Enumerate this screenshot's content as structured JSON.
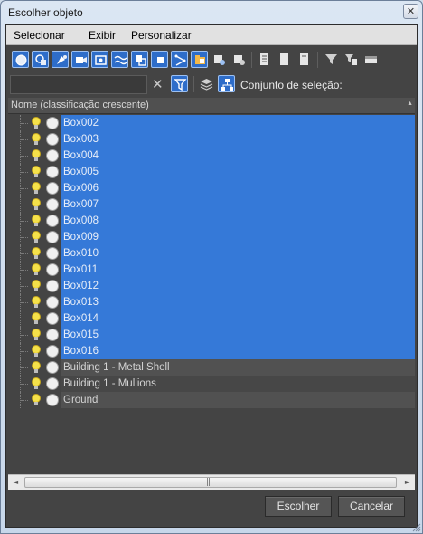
{
  "window": {
    "title": "Escolher objeto",
    "close_label": "✕"
  },
  "menu": [
    "Selecionar",
    "Exibir",
    "Personalizar"
  ],
  "filter": {
    "search_value": "",
    "clear_label": "✕",
    "selection_set_label": "Conjunto de seleção:"
  },
  "list": {
    "header": "Nome (classificação crescente)",
    "sort_indicator": "▲",
    "rows": [
      {
        "name": "Box002",
        "selected": true
      },
      {
        "name": "Box003",
        "selected": true
      },
      {
        "name": "Box004",
        "selected": true
      },
      {
        "name": "Box005",
        "selected": true
      },
      {
        "name": "Box006",
        "selected": true
      },
      {
        "name": "Box007",
        "selected": true
      },
      {
        "name": "Box008",
        "selected": true
      },
      {
        "name": "Box009",
        "selected": true
      },
      {
        "name": "Box010",
        "selected": true
      },
      {
        "name": "Box011",
        "selected": true
      },
      {
        "name": "Box012",
        "selected": true
      },
      {
        "name": "Box013",
        "selected": true
      },
      {
        "name": "Box014",
        "selected": true
      },
      {
        "name": "Box015",
        "selected": true
      },
      {
        "name": "Box016",
        "selected": true
      },
      {
        "name": "Building 1 - Metal Shell",
        "selected": false
      },
      {
        "name": "Building 1 - Mullions",
        "selected": false
      },
      {
        "name": "Ground",
        "selected": false
      }
    ]
  },
  "scrollbar": {
    "left_arrow": "◄",
    "right_arrow": "►",
    "grip": "|||"
  },
  "buttons": {
    "choose": "Escolher",
    "cancel": "Cancelar"
  },
  "colors": {
    "selection": "#3579d8",
    "panel": "#444444",
    "accent_active": "#2e6dc9"
  }
}
